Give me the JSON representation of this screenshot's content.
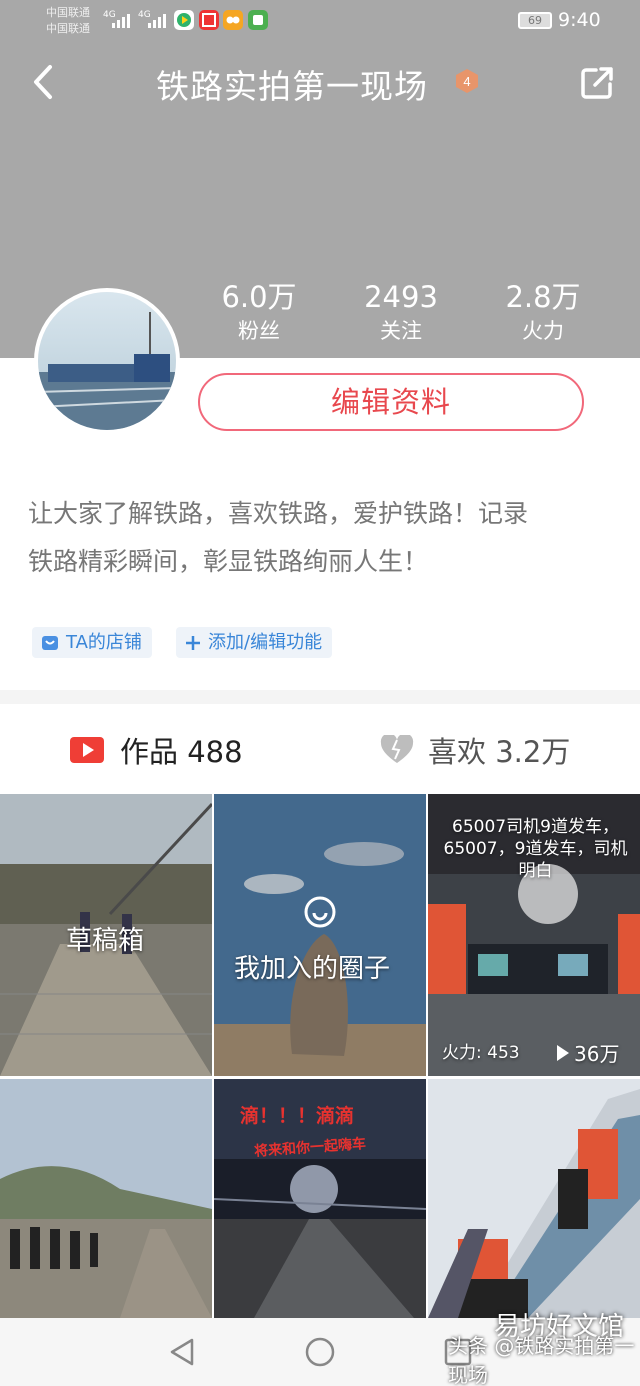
{
  "status": {
    "carrier1": "中国联通",
    "carrier2": "中国联通",
    "net1": "4G",
    "net2": "4G",
    "battery": "69",
    "time": "9:40"
  },
  "header": {
    "title": "铁路实拍第一现场",
    "level_badge": "4"
  },
  "stats": [
    {
      "value": "6.0万",
      "label": "粉丝"
    },
    {
      "value": "2493",
      "label": "关注"
    },
    {
      "value": "2.8万",
      "label": "火力"
    }
  ],
  "edit_button": "编辑资料",
  "bio_line1": "让大家了解铁路，喜欢铁路，爱护铁路！记录",
  "bio_line2": "铁路精彩瞬间，彰显铁路绚丽人生！",
  "chips": {
    "shop": "TA的店铺",
    "add": "添加/编辑功能"
  },
  "tabs": {
    "works": "作品 488",
    "likes": "喜欢 3.2万"
  },
  "grid": {
    "drafts": "草稿箱",
    "circle": "我加入的圈子",
    "video_caption": "65007司机9道发车，65007，9道发车，司机明白",
    "video_fire": "火力: 453",
    "video_plays": "36万",
    "post2_text1": "滴！！！滴滴",
    "post2_text2": "将来和你一起嗨车"
  },
  "watermark": {
    "small": "头条 @铁路实拍第一现场",
    "big": "易坊好文馆"
  },
  "colors": {
    "accent": "#e8484e",
    "link": "#3a86d8",
    "header_bg": "#a8a8a8"
  }
}
